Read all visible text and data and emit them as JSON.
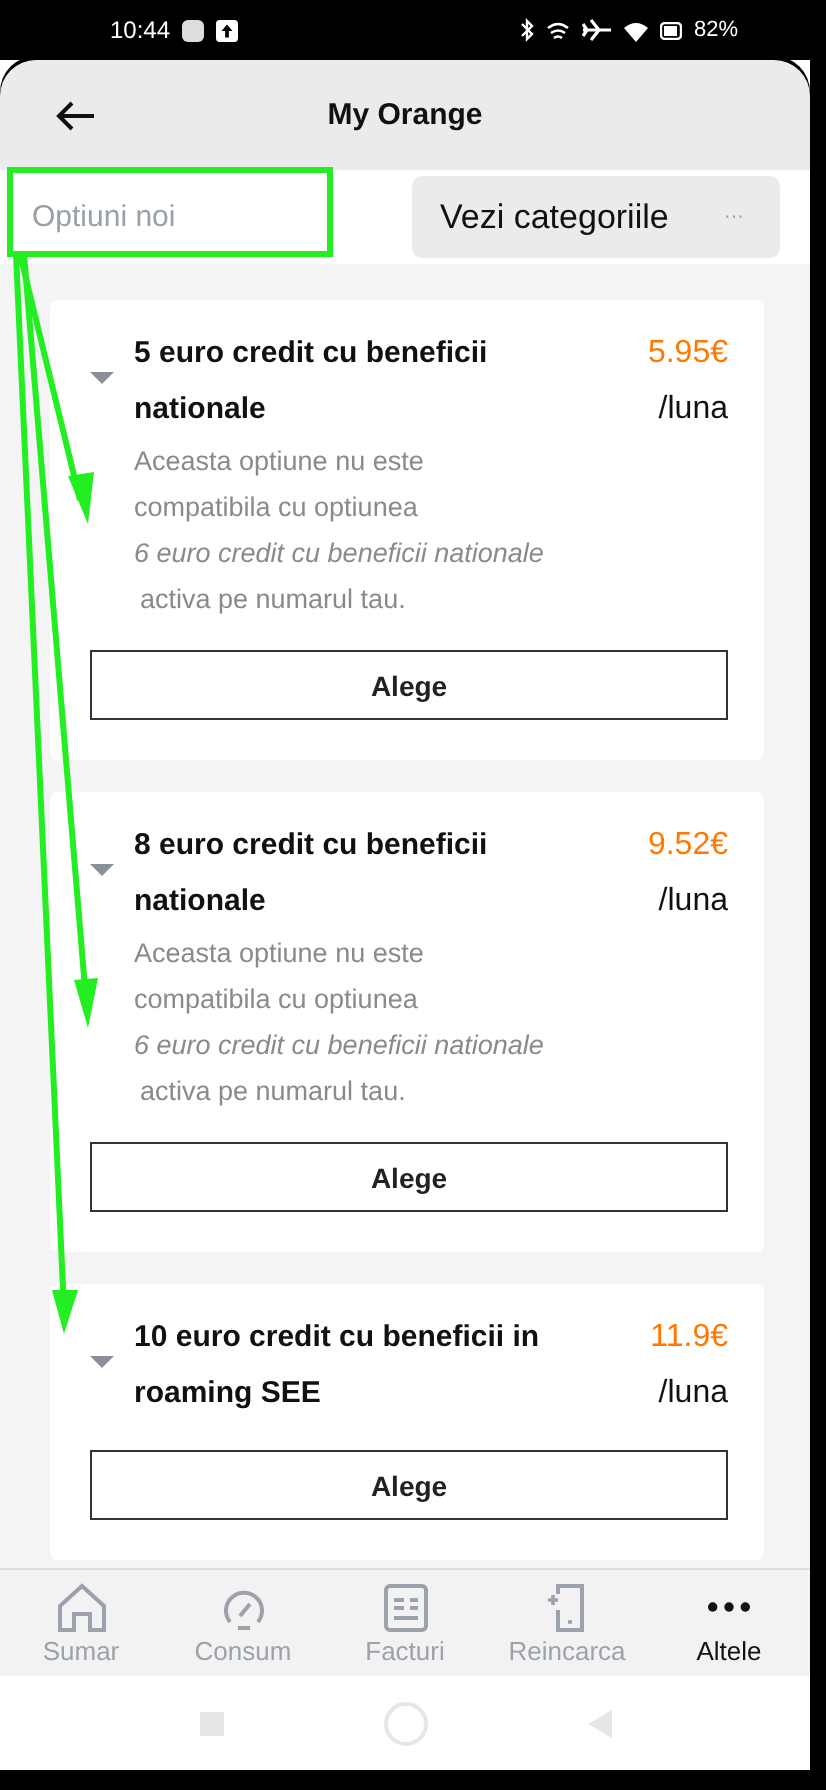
{
  "status_bar": {
    "time": "10:44",
    "battery": "82%"
  },
  "header": {
    "title": "My Orange"
  },
  "filter": {
    "placeholder": "Optiuni noi",
    "category_button": "Vezi categoriile",
    "more": "···"
  },
  "options": [
    {
      "title": "5 euro credit cu beneficii nationale",
      "price": "5.95€",
      "period": "/luna",
      "note": "Aceasta optiune nu este compatibila cu optiunea",
      "conflict": "6 euro credit cu beneficii nationale",
      "note_end": "activa pe numarul tau.",
      "button": "Alege"
    },
    {
      "title": "8 euro credit cu beneficii nationale",
      "price": "9.52€",
      "period": "/luna",
      "note": "Aceasta optiune nu este compatibila cu optiunea",
      "conflict": "6 euro credit cu beneficii nationale",
      "note_end": "activa pe numarul tau.",
      "button": "Alege"
    },
    {
      "title": "10 euro credit cu beneficii in roaming SEE",
      "price": "11.9€",
      "period": "/luna",
      "button": "Alege"
    }
  ],
  "nav": [
    {
      "kind": "home",
      "label": "Sumar",
      "selected": false
    },
    {
      "kind": "gauge",
      "label": "Consum",
      "selected": false
    },
    {
      "kind": "bill",
      "label": "Facturi",
      "selected": false
    },
    {
      "kind": "phone",
      "label": "Reincarca",
      "selected": false
    },
    {
      "kind": "more",
      "label": "Altele",
      "selected": true
    }
  ]
}
